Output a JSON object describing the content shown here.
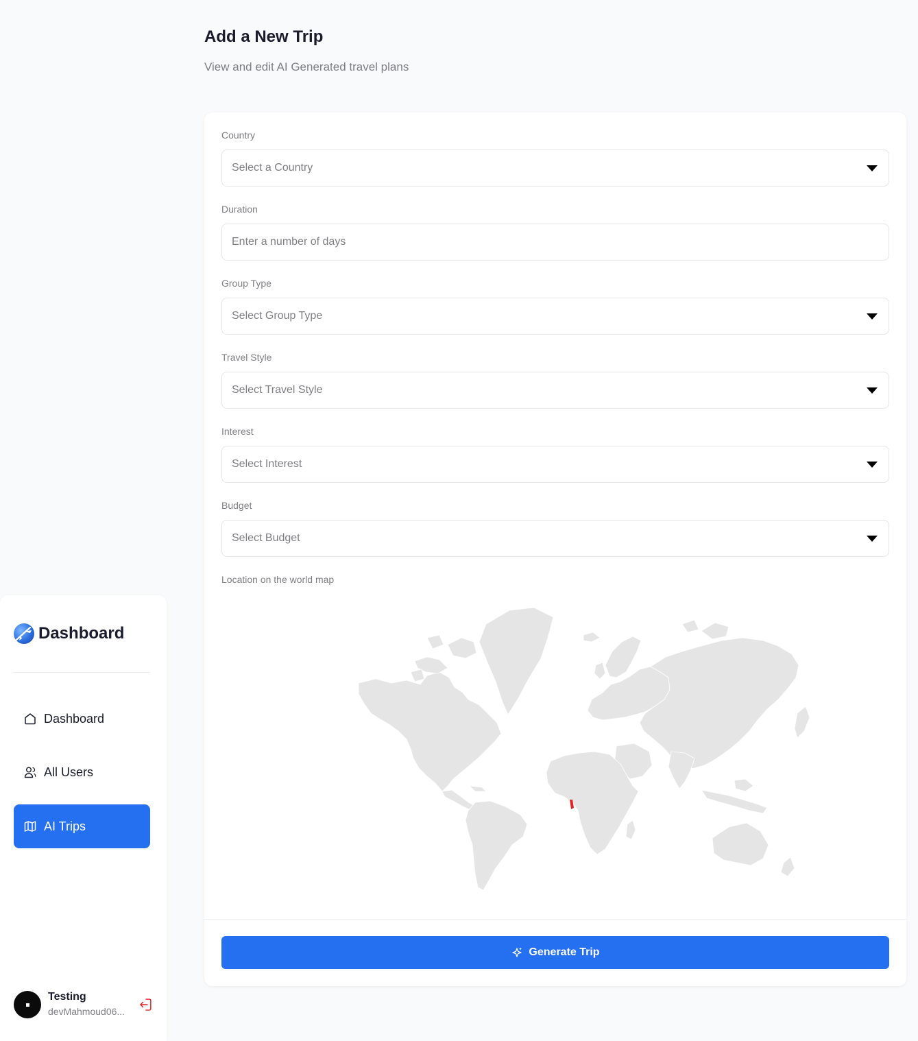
{
  "header": {
    "title": "Add a New Trip",
    "subtitle": "View and edit AI Generated travel plans"
  },
  "sidebar": {
    "brand": "Dashboard",
    "items": [
      {
        "label": "Dashboard",
        "icon": "home-icon",
        "active": false
      },
      {
        "label": "All Users",
        "icon": "users-icon",
        "active": false
      },
      {
        "label": "AI Trips",
        "icon": "map-icon",
        "active": true
      }
    ],
    "user": {
      "name": "Testing",
      "email": "devMahmoud06..."
    }
  },
  "form": {
    "country": {
      "label": "Country",
      "placeholder": "Select a Country"
    },
    "duration": {
      "label": "Duration",
      "placeholder": "Enter a number of days"
    },
    "group_type": {
      "label": "Group Type",
      "placeholder": "Select Group Type"
    },
    "travel_style": {
      "label": "Travel Style",
      "placeholder": "Select Travel Style"
    },
    "interest": {
      "label": "Interest",
      "placeholder": "Select Interest"
    },
    "budget": {
      "label": "Budget",
      "placeholder": "Select Budget"
    },
    "map_label": "Location on the world map",
    "submit_label": "Generate Trip"
  },
  "colors": {
    "accent": "#256ff1",
    "map_land": "#e5e5e5",
    "map_highlight": "#e02424",
    "logout": "#e02424"
  }
}
